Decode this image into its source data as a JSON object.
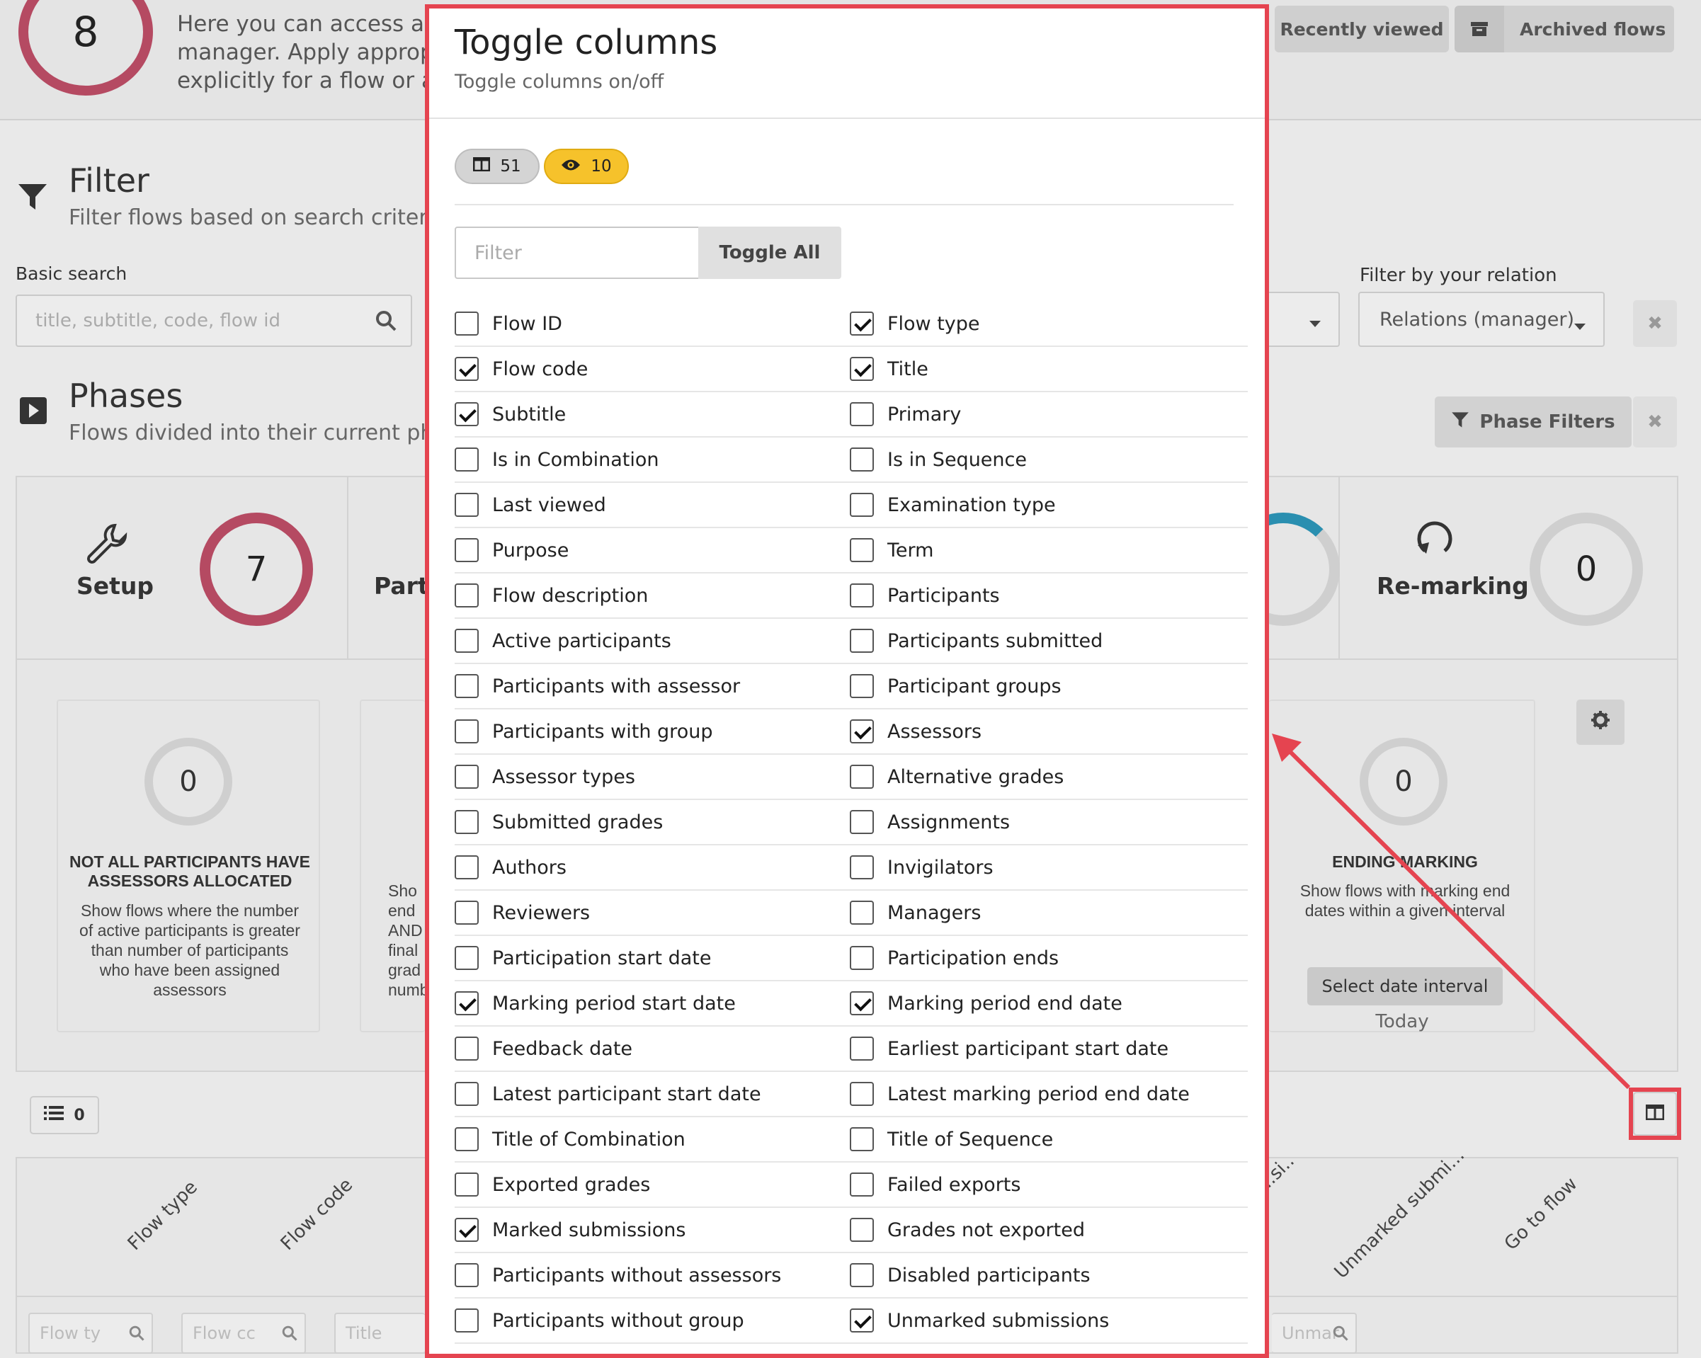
{
  "top": {
    "flows_count": "8",
    "intro_lines": [
      "Here you can access all th",
      "manager. Apply appropria",
      "explicitly for a flow or a re"
    ],
    "recently_viewed_label": "Recently viewed",
    "archived_flows_label": "Archived flows"
  },
  "filter_section": {
    "title": "Filter",
    "subtitle": "Filter flows based on search criteria",
    "basic_search_label": "Basic search",
    "basic_search_placeholder": "title, subtitle, code, flow id",
    "relation_label": "Filter by your relation",
    "relation_value": "Relations (manager)"
  },
  "phases_section": {
    "title": "Phases",
    "subtitle": "Flows divided into their current phas",
    "phase_filters_label": "Phase Filters",
    "phases": [
      {
        "name": "Setup",
        "count": "7"
      },
      {
        "name": "Parti"
      },
      {
        "name": "Re-marking",
        "count": "0"
      }
    ]
  },
  "cards": [
    {
      "count": "0",
      "title": "NOT ALL PARTICIPANTS HAVE ASSESSORS ALLOCATED",
      "desc": "Show flows where the number of active participants is greater than number of participants who have been assigned assessors"
    },
    {
      "desc_lines": [
        "Sho",
        "end",
        "AND",
        "final",
        "grad",
        "numb"
      ]
    },
    {
      "count": "0",
      "title": "ENDING MARKING",
      "desc": "Show flows with marking end dates within a given interval",
      "button": "Select date interval",
      "footer": "Today"
    }
  ],
  "table": {
    "row_count": "0",
    "headers": [
      "Flow type",
      "Flow code",
      "Unmarked submi...",
      "Go to flow",
      "...si..."
    ],
    "filters": [
      "Flow ty",
      "Flow cc",
      "Title",
      "Unmar"
    ]
  },
  "modal": {
    "title": "Toggle columns",
    "subtitle": "Toggle columns on/off",
    "total_columns": "51",
    "visible_columns": "10",
    "filter_placeholder": "Filter",
    "toggle_all_label": "Toggle All",
    "columns": [
      {
        "label": "Flow ID",
        "checked": false
      },
      {
        "label": "Flow type",
        "checked": true
      },
      {
        "label": "Flow code",
        "checked": true
      },
      {
        "label": "Title",
        "checked": true
      },
      {
        "label": "Subtitle",
        "checked": true
      },
      {
        "label": "Primary",
        "checked": false
      },
      {
        "label": "Is in Combination",
        "checked": false
      },
      {
        "label": "Is in Sequence",
        "checked": false
      },
      {
        "label": "Last viewed",
        "checked": false
      },
      {
        "label": "Examination type",
        "checked": false
      },
      {
        "label": "Purpose",
        "checked": false
      },
      {
        "label": "Term",
        "checked": false
      },
      {
        "label": "Flow description",
        "checked": false
      },
      {
        "label": "Participants",
        "checked": false
      },
      {
        "label": "Active participants",
        "checked": false
      },
      {
        "label": "Participants submitted",
        "checked": false
      },
      {
        "label": "Participants with assessor",
        "checked": false
      },
      {
        "label": "Participant groups",
        "checked": false
      },
      {
        "label": "Participants with group",
        "checked": false
      },
      {
        "label": "Assessors",
        "checked": true
      },
      {
        "label": "Assessor types",
        "checked": false
      },
      {
        "label": "Alternative grades",
        "checked": false
      },
      {
        "label": "Submitted grades",
        "checked": false
      },
      {
        "label": "Assignments",
        "checked": false
      },
      {
        "label": "Authors",
        "checked": false
      },
      {
        "label": "Invigilators",
        "checked": false
      },
      {
        "label": "Reviewers",
        "checked": false
      },
      {
        "label": "Managers",
        "checked": false
      },
      {
        "label": "Participation start date",
        "checked": false
      },
      {
        "label": "Participation ends",
        "checked": false
      },
      {
        "label": "Marking period start date",
        "checked": true
      },
      {
        "label": "Marking period end date",
        "checked": true
      },
      {
        "label": "Feedback date",
        "checked": false
      },
      {
        "label": "Earliest participant start date",
        "checked": false
      },
      {
        "label": "Latest participant start date",
        "checked": false
      },
      {
        "label": "Latest marking period end date",
        "checked": false
      },
      {
        "label": "Title of Combination",
        "checked": false
      },
      {
        "label": "Title of Sequence",
        "checked": false
      },
      {
        "label": "Exported grades",
        "checked": false
      },
      {
        "label": "Failed exports",
        "checked": false
      },
      {
        "label": "Marked submissions",
        "checked": true
      },
      {
        "label": "Grades not exported",
        "checked": false
      },
      {
        "label": "Participants without assessors",
        "checked": false
      },
      {
        "label": "Disabled participants",
        "checked": false
      },
      {
        "label": "Participants without group",
        "checked": false
      },
      {
        "label": "Unmarked submissions",
        "checked": true
      }
    ]
  },
  "colors": {
    "annotation": "#e54450",
    "visible_pill": "#f6c22b",
    "ring_red": "#b54a62"
  }
}
